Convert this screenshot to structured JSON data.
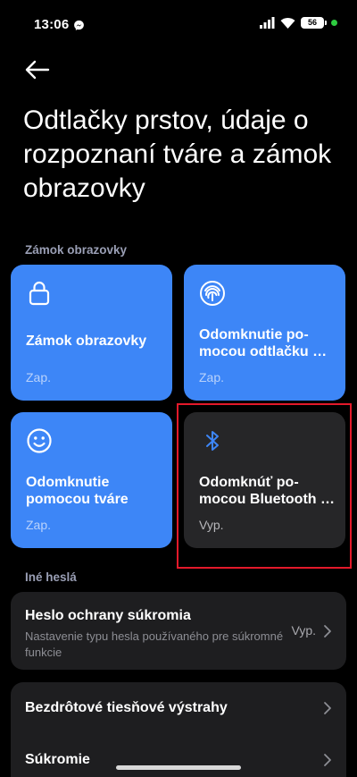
{
  "status_bar": {
    "time": "13:06",
    "battery": "56"
  },
  "page": {
    "title": "Odtlačky prstov, údaje o rozpoznaní tváre a zámok obrazovky"
  },
  "sections": {
    "screen_lock": "Zámok obrazovky",
    "other_passwords": "Iné heslá"
  },
  "tiles": [
    {
      "icon": "lock-icon",
      "label": "Zámok obrazovky",
      "status": "Zap.",
      "color": "#3d86f7"
    },
    {
      "icon": "fingerprint-icon",
      "label": "Odomknutie po-\nmocou odtlačku …",
      "status": "Zap.",
      "color": "#3d86f7"
    },
    {
      "icon": "face-icon",
      "label": "Odomknutie\npomocou tváre",
      "status": "Zap.",
      "color": "#3d86f7"
    },
    {
      "icon": "bluetooth-icon",
      "label": "Odomknúť po-\nmocou Bluetooth …",
      "status": "Vyp.",
      "color": "#262628"
    }
  ],
  "privacy_password": {
    "title": "Heslo ochrany súkromia",
    "subtitle": "Nastavenie typu hesla používaného pre súkromné funkcie",
    "value": "Vyp."
  },
  "list": {
    "emergency_alerts": "Bezdrôtové tiesňové výstrahy",
    "privacy": "Súkromie"
  },
  "colors": {
    "accent": "#3d86f7",
    "highlight": "#e3192a",
    "background": "#000000",
    "card": "#1e1e20"
  }
}
